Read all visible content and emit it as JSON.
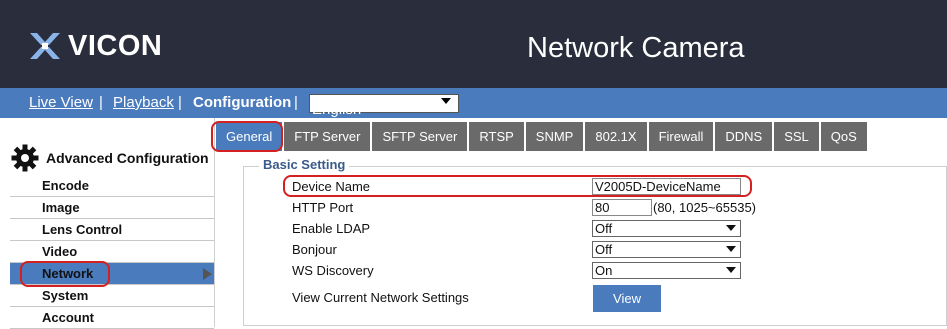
{
  "header": {
    "logo_text": "VICON",
    "title": "Network Camera"
  },
  "nav": {
    "live_view": "Live View",
    "playback": "Playback",
    "configuration": "Configuration",
    "separator": "|",
    "language": "English"
  },
  "sidebar": {
    "section_title": "Advanced Configuration",
    "section_icon": "gear-icon",
    "items": [
      {
        "label": "Encode"
      },
      {
        "label": "Image"
      },
      {
        "label": "Lens Control"
      },
      {
        "label": "Video"
      },
      {
        "label": "Network"
      },
      {
        "label": "System"
      },
      {
        "label": "Account"
      }
    ],
    "active": "Network"
  },
  "tabs": [
    "General",
    "FTP Server",
    "SFTP Server",
    "RTSP",
    "SNMP",
    "802.1X",
    "Firewall",
    "DDNS",
    "SSL",
    "QoS"
  ],
  "active_tab": "General",
  "form": {
    "legend": "Basic Setting",
    "device_name_label": "Device Name",
    "device_name_value": "V2005D-DeviceName",
    "http_port_label": "HTTP Port",
    "http_port_value": "80",
    "http_port_hint": "(80, 1025~65535)",
    "ldap_label": "Enable LDAP",
    "ldap_value": "Off",
    "bonjour_label": "Bonjour",
    "bonjour_value": "Off",
    "ws_label": "WS Discovery",
    "ws_value": "On",
    "view_label": "View Current Network Settings",
    "view_button": "View"
  },
  "colors": {
    "header_bg": "#2a2d3b",
    "accent": "#4a7bbd",
    "tab_inactive": "#6a6a6a",
    "highlight": "#d42020"
  }
}
